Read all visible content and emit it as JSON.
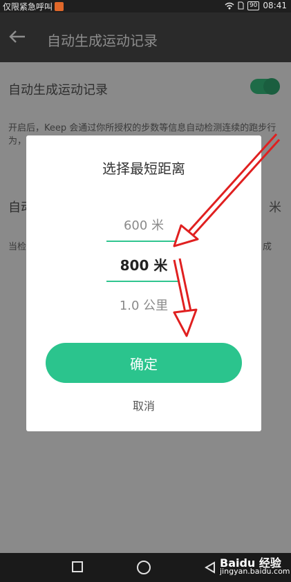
{
  "statusbar": {
    "left_text": "仅限紧急呼叫",
    "battery": "90",
    "time": "08:41"
  },
  "appbar": {
    "title": "自动生成运动记录"
  },
  "settings": {
    "row1_title": "自动生成运动记录",
    "description": "开启后，Keep 会通过你所授权的步数等信息自动检测连续的跑步行为，生成运动记录…… 录，",
    "row2_title": "自动",
    "row2_value": "米",
    "row3_text": "当检",
    "row3_end": "成"
  },
  "dialog": {
    "title": "选择最短距离",
    "options": [
      "600 米",
      "800 米",
      "1.0 公里"
    ],
    "selected": "800 米",
    "confirm_label": "确定",
    "cancel_label": "取消"
  },
  "watermark": {
    "logo": "Baidu 经验",
    "url": "jingyan.baidu.com"
  },
  "colors": {
    "accent": "#2bc48d",
    "annotation": "#e02020"
  }
}
